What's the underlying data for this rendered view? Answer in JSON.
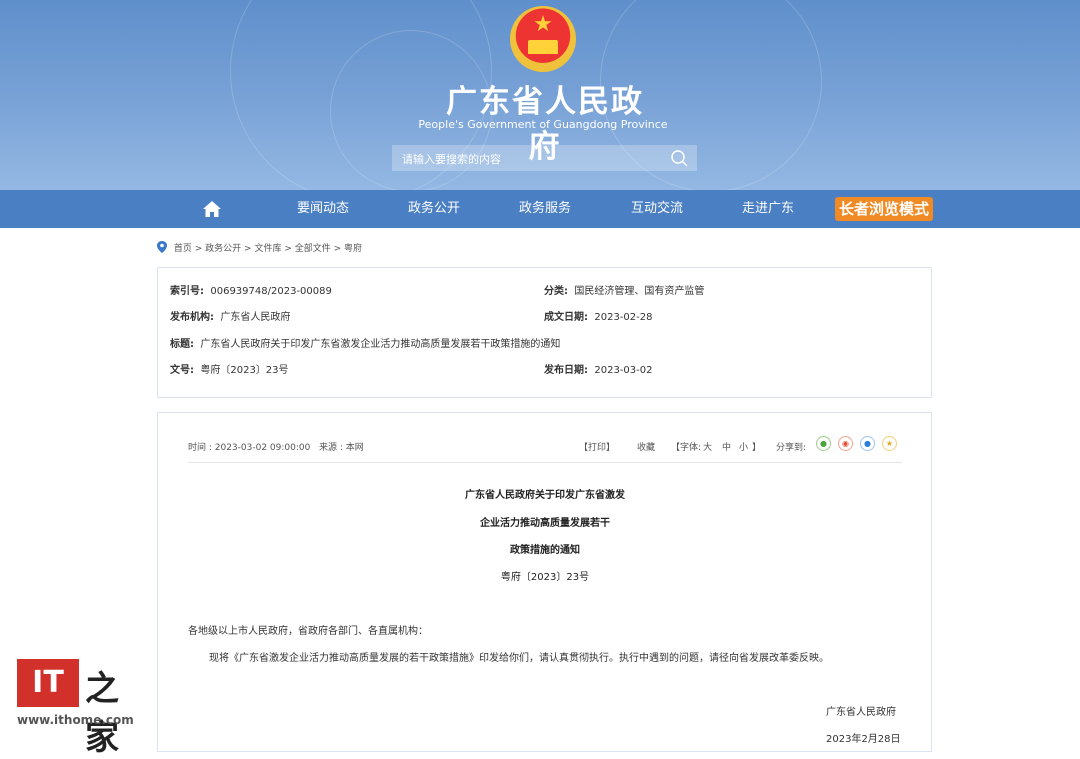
{
  "header": {
    "title": "广东省人民政府",
    "subtitle": "People's Government of Guangdong Province",
    "search_placeholder": "请输入要搜索的内容",
    "emblem_star": "★"
  },
  "nav": {
    "home_icon": "home-icon",
    "items": [
      "要闻动态",
      "政务公开",
      "政务服务",
      "互动交流",
      "走进广东"
    ],
    "elder_mode": "长者浏览模式"
  },
  "breadcrumb": [
    "首页",
    "政务公开",
    "文件库",
    "全部文件",
    "粤府"
  ],
  "info": {
    "index_label": "索引号:",
    "index_value": "006939748/2023-00089",
    "category_label": "分类:",
    "category_value": "国民经济管理、国有资产监管",
    "publisher_label": "发布机构:",
    "publisher_value": "广东省人民政府",
    "written_label": "成文日期:",
    "written_value": "2023-02-28",
    "subject_label": "标题:",
    "subject_value": "广东省人民政府关于印发广东省激发企业活力推动高质量发展若干政策措施的通知",
    "docno_label": "文号:",
    "docno_value": "粤府〔2023〕23号",
    "pubdate_label": "发布日期:",
    "pubdate_value": "2023-03-02"
  },
  "toolbar": {
    "time": "时间 : 2023-03-02 09:00:00",
    "source": "来源 : 本网",
    "print": "【打印】",
    "favorite": "收藏",
    "font_open": "【字体:",
    "font_large": "大",
    "font_medium": "中",
    "font_small": "小",
    "font_close": "】",
    "share_label": "分享到:",
    "share_icons": [
      "wechat-icon",
      "weibo-icon",
      "qq-icon",
      "qzone-icon"
    ]
  },
  "article": {
    "title_line1": "广东省人民政府关于印发广东省激发",
    "title_line2": "企业活力推动高质量发展若干",
    "title_line3": "政策措施的通知",
    "doc_no": "粤府〔2023〕23号",
    "salutation": "各地级以上市人民政府，省政府各部门、各直属机构：",
    "body": "现将《广东省激发企业活力推动高质量发展的若干政策措施》印发给你们，请认真贯彻执行。执行中遇到的问题，请径向省发展改革委反映。",
    "signature": "广东省人民政府",
    "date": "2023年2月28日"
  },
  "watermark": {
    "logo_text": "IT",
    "logo_cn": "之家",
    "url": "www.ithome.com"
  },
  "colors": {
    "nav_bg": "#4a7fc4",
    "elder_bg": "#f08a24",
    "banner_top": "#5f8fcb"
  }
}
